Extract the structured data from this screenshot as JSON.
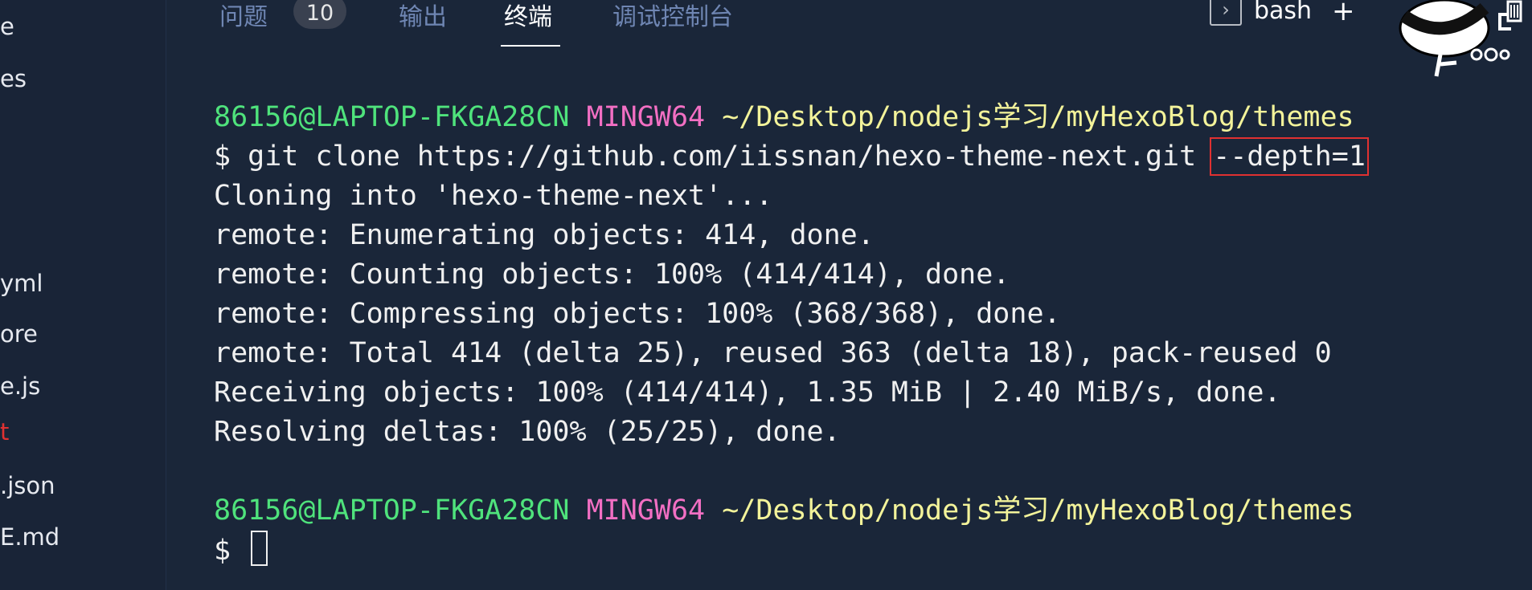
{
  "sidebar": {
    "items": [
      {
        "label": "e"
      },
      {
        "label": "es"
      },
      {
        "label": "yml"
      },
      {
        "label": "ore"
      },
      {
        "label": "e.js"
      },
      {
        "label": "t",
        "color": "#e03131"
      },
      {
        "label": ".json"
      },
      {
        "label": "E.md"
      }
    ]
  },
  "panel": {
    "tabs": [
      {
        "label": "问题"
      },
      {
        "label": "输出"
      },
      {
        "label": "终端",
        "active": true
      },
      {
        "label": "调试控制台"
      }
    ],
    "problems_count": "10",
    "terminal_name": "bash",
    "icons": [
      "terminal-icon",
      "plus-icon",
      "trash-icon",
      "mascot-sticker"
    ]
  },
  "terminal": {
    "prompt1": {
      "user": "86156@LAPTOP-FKGA28CN",
      "env": "MINGW64",
      "path": "~/Desktop/nodejs学习/myHexoBlog/themes"
    },
    "command": "$ git clone https://github.com/iissnan/hexo-theme-next.git ",
    "command_highlight": "--depth=1",
    "output": [
      "Cloning into 'hexo-theme-next'...",
      "remote: Enumerating objects: 414, done.",
      "remote: Counting objects: 100% (414/414), done.",
      "remote: Compressing objects: 100% (368/368), done.",
      "remote: Total 414 (delta 25), reused 363 (delta 18), pack-reused 0",
      "Receiving objects: 100% (414/414), 1.35 MiB | 2.40 MiB/s, done.",
      "Resolving deltas: 100% (25/25), done."
    ],
    "prompt2": {
      "user": "86156@LAPTOP-FKGA28CN",
      "env": "MINGW64",
      "path": "~/Desktop/nodejs学习/myHexoBlog/themes"
    },
    "prompt_symbol": "$",
    "colors": {
      "user": "#4fe37c",
      "env": "#f26fc3",
      "path": "#f3f39a",
      "highlight_box": "#e03131"
    }
  }
}
